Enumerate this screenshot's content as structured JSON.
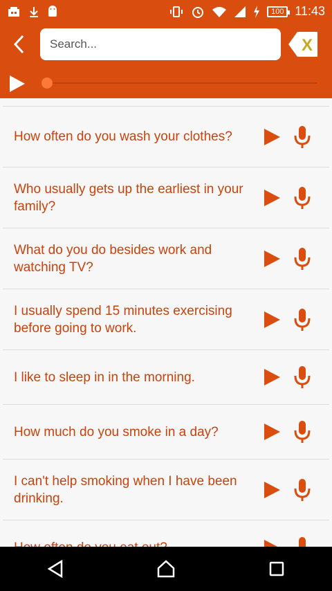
{
  "status_bar": {
    "battery": "100",
    "time": "11:43"
  },
  "app_bar": {
    "search_placeholder": "Search...",
    "clear_label": "X"
  },
  "player": {
    "progress": 0
  },
  "phrases": [
    "How often do you wash your clothes?",
    "Who usually gets up the earliest in your family?",
    "What do you do besides work and watching TV?",
    "I usually spend 15 minutes exercising before going to work.",
    "I like to sleep in in the morning.",
    "How much do you smoke in a day?",
    "I can't help smoking when I have been drinking.",
    "How often do you eat out?"
  ],
  "colors": {
    "accent": "#d94e0f",
    "text": "#c8420c",
    "clear_icon": "#c9a81f"
  }
}
